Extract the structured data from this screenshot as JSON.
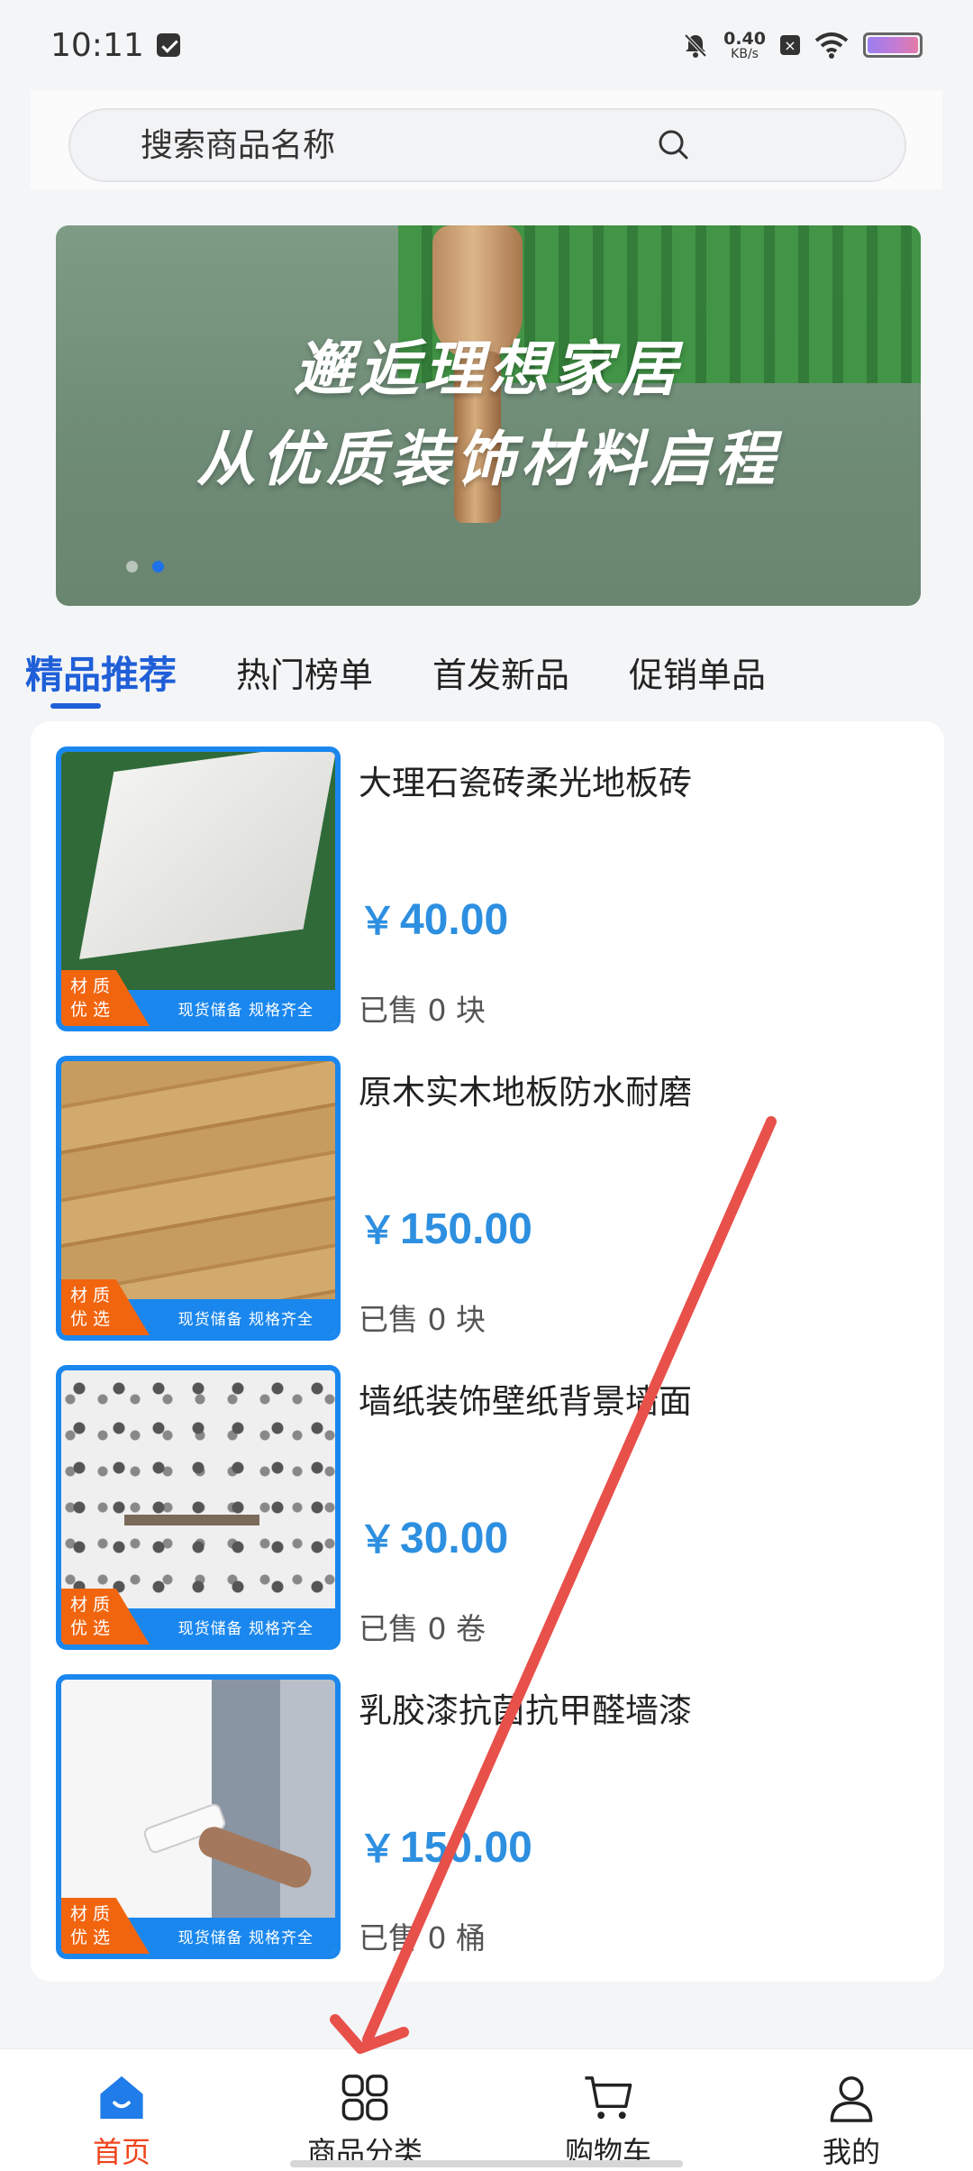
{
  "status_bar": {
    "time": "10:11",
    "net_speed_value": "0.40",
    "net_speed_unit": "KB/s"
  },
  "search": {
    "placeholder": "搜索商品名称"
  },
  "banner": {
    "line1": "邂逅理想家居",
    "line2": "从优质装饰材料启程",
    "active_dot": 1
  },
  "tabs": [
    {
      "label": "精品推荐",
      "active": true
    },
    {
      "label": "热门榜单"
    },
    {
      "label": "首发新品"
    },
    {
      "label": "促销单品"
    }
  ],
  "thumb_badge": {
    "line1": "材 质",
    "line2": "优 选",
    "strip": "现货储备  规格齐全"
  },
  "products": [
    {
      "name": "大理石瓷砖柔光地板砖",
      "currency": "￥",
      "price": "40.00",
      "sold": "已售 0 块"
    },
    {
      "name": "原木实木地板防水耐磨",
      "currency": "￥",
      "price": "150.00",
      "sold": "已售 0 块"
    },
    {
      "name": "墙纸装饰壁纸背景墙面",
      "currency": "￥",
      "price": "30.00",
      "sold": "已售 0 卷"
    },
    {
      "name": "乳胶漆抗菌抗甲醛墙漆",
      "currency": "￥",
      "price": "150.00",
      "sold": "已售 0 桶"
    }
  ],
  "bottom_nav": [
    {
      "label": "首页",
      "icon": "home-icon",
      "active": true
    },
    {
      "label": "商品分类",
      "icon": "category-grid-icon"
    },
    {
      "label": "购物车",
      "icon": "cart-icon"
    },
    {
      "label": "我的",
      "icon": "user-icon"
    }
  ],
  "colors": {
    "primary_blue": "#1f5fd8",
    "price_blue": "#2d8fe0",
    "active_nav": "#f0441b",
    "badge_orange": "#f2650f",
    "annotation_red": "#e8504a"
  }
}
